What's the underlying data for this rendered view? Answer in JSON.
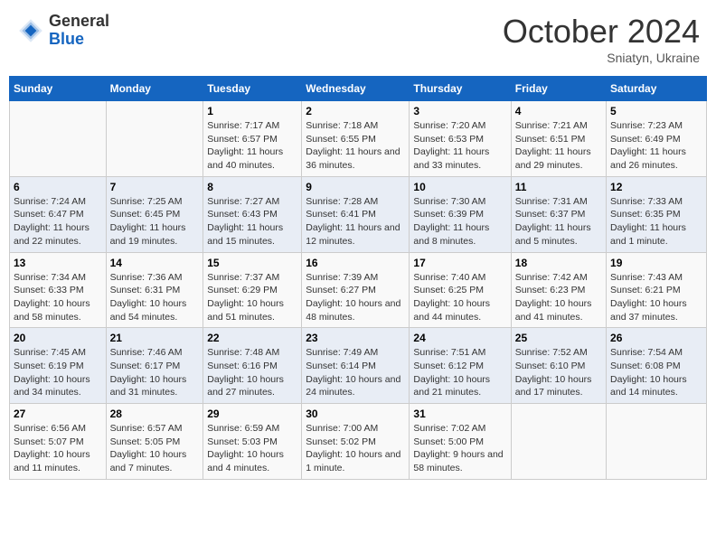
{
  "header": {
    "logo_general": "General",
    "logo_blue": "Blue",
    "month_title": "October 2024",
    "location": "Sniatyn, Ukraine"
  },
  "days_of_week": [
    "Sunday",
    "Monday",
    "Tuesday",
    "Wednesday",
    "Thursday",
    "Friday",
    "Saturday"
  ],
  "weeks": [
    [
      {
        "day": "",
        "sunrise": "",
        "sunset": "",
        "daylight": ""
      },
      {
        "day": "",
        "sunrise": "",
        "sunset": "",
        "daylight": ""
      },
      {
        "day": "1",
        "sunrise": "Sunrise: 7:17 AM",
        "sunset": "Sunset: 6:57 PM",
        "daylight": "Daylight: 11 hours and 40 minutes."
      },
      {
        "day": "2",
        "sunrise": "Sunrise: 7:18 AM",
        "sunset": "Sunset: 6:55 PM",
        "daylight": "Daylight: 11 hours and 36 minutes."
      },
      {
        "day": "3",
        "sunrise": "Sunrise: 7:20 AM",
        "sunset": "Sunset: 6:53 PM",
        "daylight": "Daylight: 11 hours and 33 minutes."
      },
      {
        "day": "4",
        "sunrise": "Sunrise: 7:21 AM",
        "sunset": "Sunset: 6:51 PM",
        "daylight": "Daylight: 11 hours and 29 minutes."
      },
      {
        "day": "5",
        "sunrise": "Sunrise: 7:23 AM",
        "sunset": "Sunset: 6:49 PM",
        "daylight": "Daylight: 11 hours and 26 minutes."
      }
    ],
    [
      {
        "day": "6",
        "sunrise": "Sunrise: 7:24 AM",
        "sunset": "Sunset: 6:47 PM",
        "daylight": "Daylight: 11 hours and 22 minutes."
      },
      {
        "day": "7",
        "sunrise": "Sunrise: 7:25 AM",
        "sunset": "Sunset: 6:45 PM",
        "daylight": "Daylight: 11 hours and 19 minutes."
      },
      {
        "day": "8",
        "sunrise": "Sunrise: 7:27 AM",
        "sunset": "Sunset: 6:43 PM",
        "daylight": "Daylight: 11 hours and 15 minutes."
      },
      {
        "day": "9",
        "sunrise": "Sunrise: 7:28 AM",
        "sunset": "Sunset: 6:41 PM",
        "daylight": "Daylight: 11 hours and 12 minutes."
      },
      {
        "day": "10",
        "sunrise": "Sunrise: 7:30 AM",
        "sunset": "Sunset: 6:39 PM",
        "daylight": "Daylight: 11 hours and 8 minutes."
      },
      {
        "day": "11",
        "sunrise": "Sunrise: 7:31 AM",
        "sunset": "Sunset: 6:37 PM",
        "daylight": "Daylight: 11 hours and 5 minutes."
      },
      {
        "day": "12",
        "sunrise": "Sunrise: 7:33 AM",
        "sunset": "Sunset: 6:35 PM",
        "daylight": "Daylight: 11 hours and 1 minute."
      }
    ],
    [
      {
        "day": "13",
        "sunrise": "Sunrise: 7:34 AM",
        "sunset": "Sunset: 6:33 PM",
        "daylight": "Daylight: 10 hours and 58 minutes."
      },
      {
        "day": "14",
        "sunrise": "Sunrise: 7:36 AM",
        "sunset": "Sunset: 6:31 PM",
        "daylight": "Daylight: 10 hours and 54 minutes."
      },
      {
        "day": "15",
        "sunrise": "Sunrise: 7:37 AM",
        "sunset": "Sunset: 6:29 PM",
        "daylight": "Daylight: 10 hours and 51 minutes."
      },
      {
        "day": "16",
        "sunrise": "Sunrise: 7:39 AM",
        "sunset": "Sunset: 6:27 PM",
        "daylight": "Daylight: 10 hours and 48 minutes."
      },
      {
        "day": "17",
        "sunrise": "Sunrise: 7:40 AM",
        "sunset": "Sunset: 6:25 PM",
        "daylight": "Daylight: 10 hours and 44 minutes."
      },
      {
        "day": "18",
        "sunrise": "Sunrise: 7:42 AM",
        "sunset": "Sunset: 6:23 PM",
        "daylight": "Daylight: 10 hours and 41 minutes."
      },
      {
        "day": "19",
        "sunrise": "Sunrise: 7:43 AM",
        "sunset": "Sunset: 6:21 PM",
        "daylight": "Daylight: 10 hours and 37 minutes."
      }
    ],
    [
      {
        "day": "20",
        "sunrise": "Sunrise: 7:45 AM",
        "sunset": "Sunset: 6:19 PM",
        "daylight": "Daylight: 10 hours and 34 minutes."
      },
      {
        "day": "21",
        "sunrise": "Sunrise: 7:46 AM",
        "sunset": "Sunset: 6:17 PM",
        "daylight": "Daylight: 10 hours and 31 minutes."
      },
      {
        "day": "22",
        "sunrise": "Sunrise: 7:48 AM",
        "sunset": "Sunset: 6:16 PM",
        "daylight": "Daylight: 10 hours and 27 minutes."
      },
      {
        "day": "23",
        "sunrise": "Sunrise: 7:49 AM",
        "sunset": "Sunset: 6:14 PM",
        "daylight": "Daylight: 10 hours and 24 minutes."
      },
      {
        "day": "24",
        "sunrise": "Sunrise: 7:51 AM",
        "sunset": "Sunset: 6:12 PM",
        "daylight": "Daylight: 10 hours and 21 minutes."
      },
      {
        "day": "25",
        "sunrise": "Sunrise: 7:52 AM",
        "sunset": "Sunset: 6:10 PM",
        "daylight": "Daylight: 10 hours and 17 minutes."
      },
      {
        "day": "26",
        "sunrise": "Sunrise: 7:54 AM",
        "sunset": "Sunset: 6:08 PM",
        "daylight": "Daylight: 10 hours and 14 minutes."
      }
    ],
    [
      {
        "day": "27",
        "sunrise": "Sunrise: 6:56 AM",
        "sunset": "Sunset: 5:07 PM",
        "daylight": "Daylight: 10 hours and 11 minutes."
      },
      {
        "day": "28",
        "sunrise": "Sunrise: 6:57 AM",
        "sunset": "Sunset: 5:05 PM",
        "daylight": "Daylight: 10 hours and 7 minutes."
      },
      {
        "day": "29",
        "sunrise": "Sunrise: 6:59 AM",
        "sunset": "Sunset: 5:03 PM",
        "daylight": "Daylight: 10 hours and 4 minutes."
      },
      {
        "day": "30",
        "sunrise": "Sunrise: 7:00 AM",
        "sunset": "Sunset: 5:02 PM",
        "daylight": "Daylight: 10 hours and 1 minute."
      },
      {
        "day": "31",
        "sunrise": "Sunrise: 7:02 AM",
        "sunset": "Sunset: 5:00 PM",
        "daylight": "Daylight: 9 hours and 58 minutes."
      },
      {
        "day": "",
        "sunrise": "",
        "sunset": "",
        "daylight": ""
      },
      {
        "day": "",
        "sunrise": "",
        "sunset": "",
        "daylight": ""
      }
    ]
  ]
}
